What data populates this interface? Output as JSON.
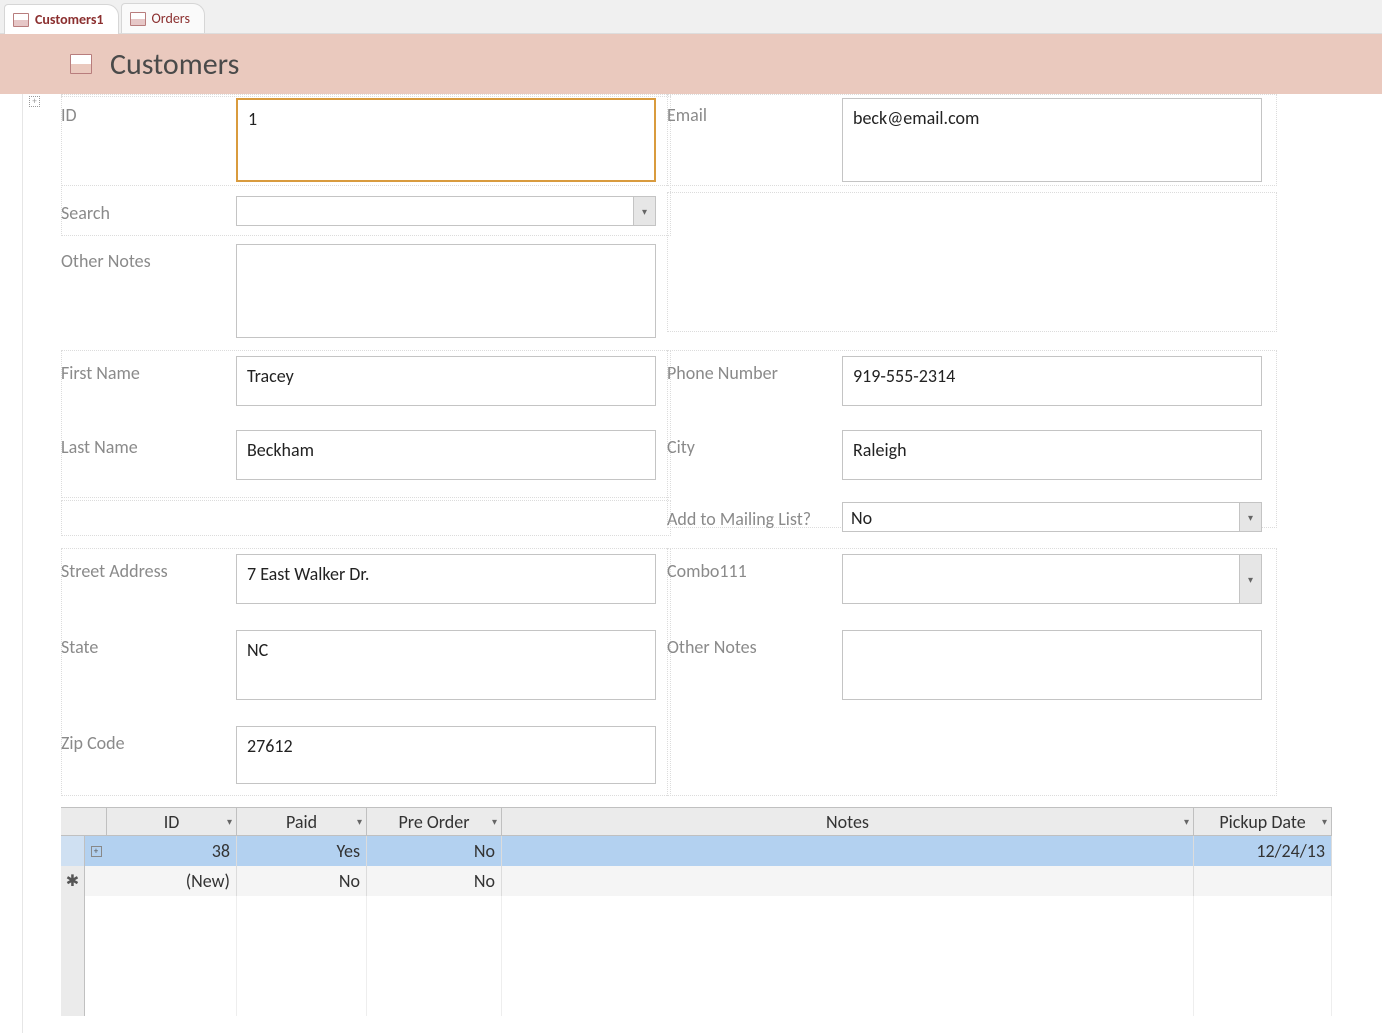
{
  "tabs": [
    {
      "label": "Customers1",
      "active": true
    },
    {
      "label": "Orders",
      "active": false
    }
  ],
  "header": {
    "title": "Customers"
  },
  "form": {
    "left": {
      "id": {
        "label": "ID",
        "value": "1"
      },
      "search": {
        "label": "Search",
        "value": ""
      },
      "other_notes": {
        "label": "Other Notes",
        "value": ""
      },
      "first_name": {
        "label": "First Name",
        "value": "Tracey"
      },
      "last_name": {
        "label": "Last Name",
        "value": "Beckham"
      },
      "street": {
        "label": "Street Address",
        "value": "7 East Walker Dr."
      },
      "state": {
        "label": "State",
        "value": "NC"
      },
      "zip": {
        "label": "Zip Code",
        "value": "27612"
      }
    },
    "right": {
      "email": {
        "label": "Email",
        "value": "beck@email.com"
      },
      "phone": {
        "label": "Phone Number",
        "value": "919-555-2314"
      },
      "city": {
        "label": "City",
        "value": "Raleigh"
      },
      "mailing": {
        "label": "Add to Mailing List?",
        "value": "No"
      },
      "combo111": {
        "label": "Combo111",
        "value": ""
      },
      "other_notes": {
        "label": "Other Notes",
        "value": ""
      }
    }
  },
  "subform": {
    "columns": [
      "ID",
      "Paid",
      "Pre Order",
      "Notes",
      "Pickup Date"
    ],
    "rows": [
      {
        "id": "38",
        "paid": "Yes",
        "pre": "No",
        "notes": "",
        "pick": "12/24/13",
        "selected": true,
        "expand": true
      }
    ],
    "newrow": {
      "id": "(New)",
      "paid": "No",
      "pre": "No",
      "notes": "",
      "pick": ""
    }
  }
}
